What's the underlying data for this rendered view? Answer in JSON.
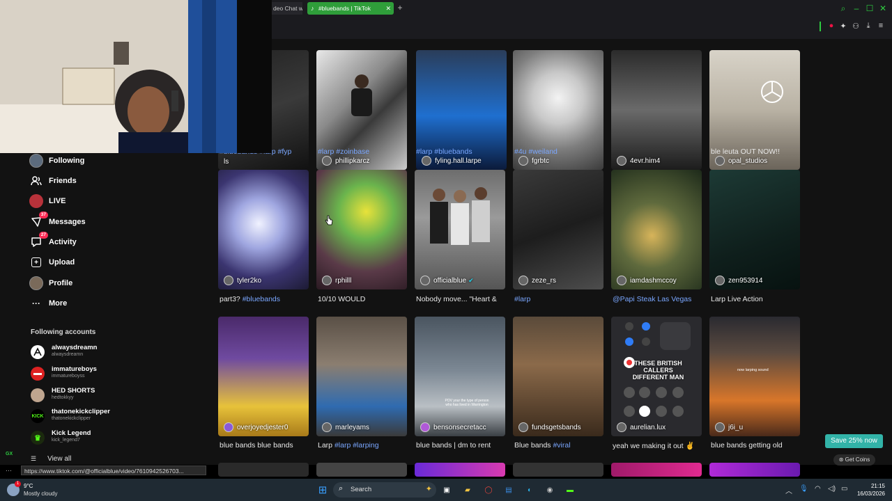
{
  "browser": {
    "prev_tab_label": "deo Chat w",
    "active_tab_label": "#bluebands | TikTok",
    "tab_icon": "tiktok-icon",
    "new_tab": "+",
    "ext_badge": "1"
  },
  "sidebar": {
    "nav": [
      {
        "label": "Following"
      },
      {
        "label": "Friends"
      },
      {
        "label": "LIVE"
      },
      {
        "label": "Messages",
        "badge": "37"
      },
      {
        "label": "Activity",
        "badge": "27"
      },
      {
        "label": "Upload"
      },
      {
        "label": "Profile"
      },
      {
        "label": "More"
      }
    ],
    "following_title": "Following accounts",
    "accounts": [
      {
        "name": "alwaysdreamn",
        "handle": "alwaysdreamn"
      },
      {
        "name": "immatureboys",
        "handle": "immatureboyss"
      },
      {
        "name": "HED SHORTS",
        "handle": "hedtokkyy"
      },
      {
        "name": "thatonekickclipper",
        "handle": "thatonekickclipper"
      },
      {
        "name": "Kick Legend",
        "handle": "kick_legend7"
      }
    ],
    "kick_logo": "KICK",
    "view_all": "View all"
  },
  "grid": {
    "row1": [
      {
        "user": "ls",
        "desc": "#bluebands #larp #fyp",
        "tag": true
      },
      {
        "user": "phillipkarcz",
        "desc": "#larp #zoinbase",
        "tag": true
      },
      {
        "user": "fyling.hall.larpe",
        "desc": "#larp #bluebands",
        "tag": true
      },
      {
        "user": "fgrbtc",
        "desc": "#4u #weiland",
        "tag": true
      },
      {
        "user": "4evr.him4",
        "desc": "",
        "tag": false
      },
      {
        "user": "opal_studios",
        "desc": "ble leuta OUT NOW!!",
        "tag": false
      }
    ],
    "row2": [
      {
        "user": "tyler2ko",
        "desc_a": "part3? ",
        "desc_b": "#bluebands"
      },
      {
        "user": "rphilll",
        "desc_a": "10/10 WOULD",
        "desc_b": ""
      },
      {
        "user": "officialblue",
        "desc_a": "Nobody move... \"Heart &",
        "desc_b": ""
      },
      {
        "user": "zeze_rs",
        "desc_a": "",
        "desc_b": "#larp"
      },
      {
        "user": "iamdashmccoy",
        "desc_a": "",
        "desc_b": "@Papi Steak Las Vegas"
      },
      {
        "user": "zen953914",
        "desc_a": "Larp Live Action",
        "desc_b": ""
      }
    ],
    "row3": [
      {
        "user": "overjoyedjester0",
        "desc_a": "blue bands blue bands",
        "desc_b": ""
      },
      {
        "user": "marleyams",
        "desc_a": "Larp ",
        "desc_b": "#larp #larping"
      },
      {
        "user": "bensonsecretacc",
        "desc_a": "blue bands | dm to rent",
        "desc_b": ""
      },
      {
        "user": "fundsgetsbands",
        "desc_a": "Blue bands ",
        "desc_b": "#viral"
      },
      {
        "user": "aurelian.lux",
        "desc_a": "yeah we making it out ✌",
        "desc_b": ""
      },
      {
        "user": "j6i_u",
        "desc_a": "blue bands getting old",
        "desc_b": ""
      }
    ],
    "overlay_text": "THESE BRITISH CALLERS DIFFERENT MAN",
    "gym_text": "POV your the type of person who has lived in Warrington",
    "phone_text": "now larping sound"
  },
  "status_url": "https://www.tiktok.com/@officialblue/video/7610942526703...",
  "promo": {
    "save": "Save 25% now",
    "coins": "Get Coins"
  },
  "taskbar": {
    "temp": "9°C",
    "condition": "Mostly cloudy",
    "weather_badge": "1",
    "search_label": "Search",
    "time": "21:15",
    "date": "16/03/2026"
  },
  "gx_label": "GX"
}
